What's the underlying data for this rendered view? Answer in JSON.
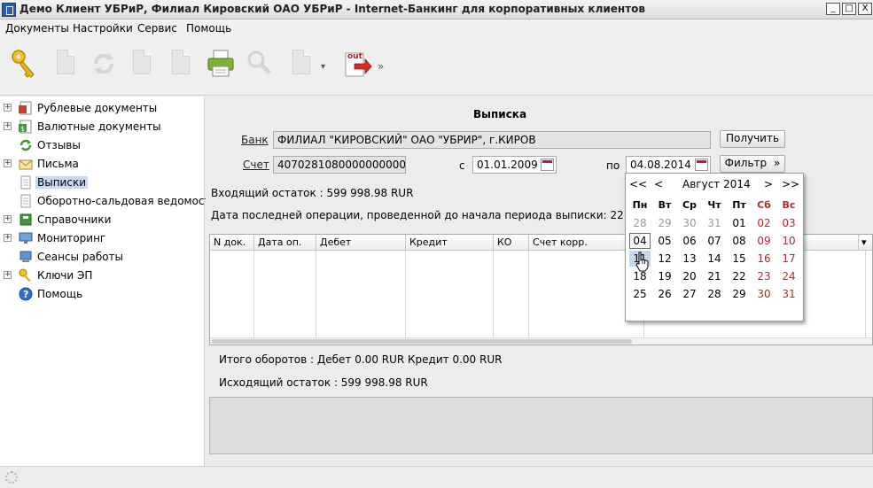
{
  "window": {
    "title": "Демо Клиент УБРиР, Филиал Кировский ОАО УБРиР - Internet-Банкинг для корпоративных клиентов",
    "minimize": "_",
    "maximize": "□",
    "close": "X"
  },
  "menu": [
    "Документы",
    "Настройки",
    "Сервис",
    "Помощь"
  ],
  "toolbar": {
    "out_label": "out",
    "dropdown_glyph": "»"
  },
  "nav": [
    {
      "label": "Рублевые документы",
      "icon": "ruble-docs-icon",
      "expandable": true
    },
    {
      "label": "Валютные документы",
      "icon": "currency-docs-icon",
      "expandable": true
    },
    {
      "label": "Отзывы",
      "icon": "refresh-icon",
      "expandable": false
    },
    {
      "label": "Письма",
      "icon": "envelope-icon",
      "expandable": true
    },
    {
      "label": "Выписки",
      "icon": "document-icon",
      "expandable": false,
      "selected": true
    },
    {
      "label": "Оборотно-сальдовая ведомость",
      "icon": "document-icon",
      "expandable": false
    },
    {
      "label": "Справочники",
      "icon": "book-icon",
      "expandable": true
    },
    {
      "label": "Мониторинг",
      "icon": "monitor-icon",
      "expandable": true
    },
    {
      "label": "Сеансы работы",
      "icon": "computer-icon",
      "expandable": false
    },
    {
      "label": "Ключи ЭП",
      "icon": "key-icon",
      "expandable": true
    },
    {
      "label": "Помощь",
      "icon": "help-icon",
      "expandable": false
    }
  ],
  "form": {
    "title": "Выписка",
    "bank_label": "Банк",
    "bank_value": "ФИЛИАЛ \"КИРОВСКИЙ\" ОАО \"УБРИР\", г.КИРОВ",
    "get_button": "Получить",
    "account_label": "Счет",
    "account_value": "40702810800000000000",
    "from_label": "с",
    "from_value": "01.01.2009",
    "to_label": "по",
    "to_value": "04.08.2014",
    "filter_button": "Фильтр",
    "filter_glyph": "»",
    "opening_balance": "Входящий остаток :  599 998.98  RUR",
    "last_op_date": "Дата последней операции, проведенной до начала периода выписки: 22.05.2009"
  },
  "table": {
    "columns": [
      "N док.",
      "Дата оп.",
      "Дебет",
      "Кредит",
      "КО",
      "Счет корр."
    ],
    "menu_glyph": "▾"
  },
  "totals": {
    "turnover": "Итого оборотов :  Дебет  0.00  RUR   Кредит  0.00  RUR",
    "closing_balance": "Исходящий остаток :  599 998.98  RUR"
  },
  "calendar": {
    "prev_year": "<<",
    "prev_month": "<",
    "month_title": "Август 2014",
    "next_month": ">",
    "next_year": ">>",
    "weekdays": [
      "Пн",
      "Вт",
      "Ср",
      "Чт",
      "Пт",
      "Сб",
      "Вс"
    ],
    "weeks": [
      [
        "28",
        "29",
        "30",
        "31",
        "01",
        "02",
        "03"
      ],
      [
        "04",
        "05",
        "06",
        "07",
        "08",
        "09",
        "10"
      ],
      [
        "11",
        "12",
        "13",
        "14",
        "15",
        "16",
        "17"
      ],
      [
        "18",
        "19",
        "20",
        "21",
        "22",
        "23",
        "24"
      ],
      [
        "25",
        "26",
        "27",
        "28",
        "29",
        "30",
        "31"
      ]
    ],
    "weekend_color": "#c0262a",
    "today": "04"
  }
}
